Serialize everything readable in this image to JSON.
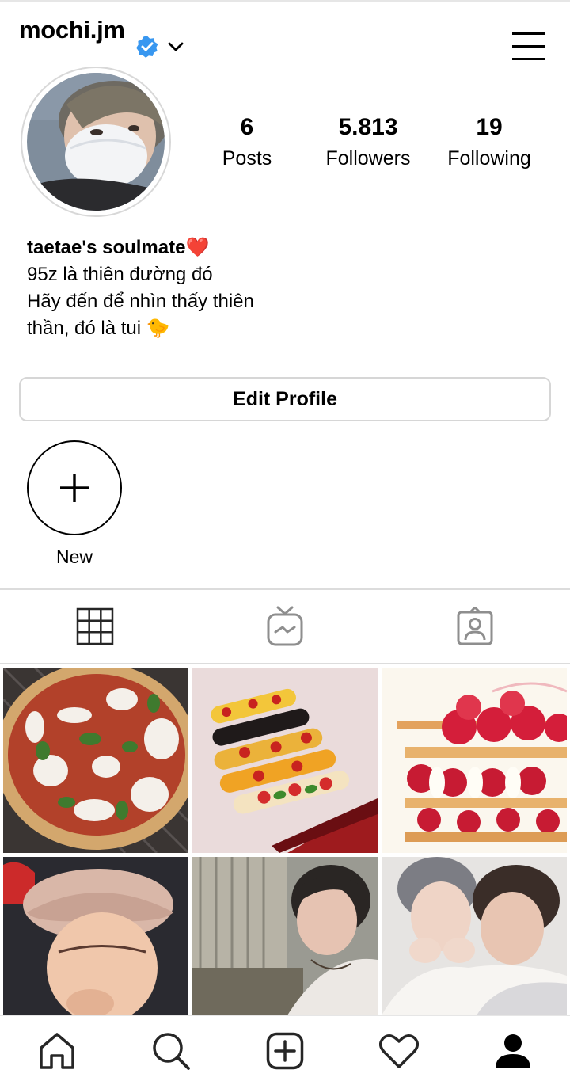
{
  "header": {
    "username": "mochi.jm",
    "verified_icon": "verified-badge-icon",
    "dropdown_icon": "chevron-down-icon",
    "menu_icon": "hamburger-menu-icon"
  },
  "stats": {
    "posts": {
      "value": "6",
      "label": "Posts"
    },
    "followers": {
      "value": "5.813",
      "label": "Followers"
    },
    "following": {
      "value": "19",
      "label": "Following"
    }
  },
  "bio": {
    "name": "taetae's soulmate",
    "name_emoji": "❤️",
    "line1": "95z là thiên đường đó",
    "line2": "Hãy đến để nhìn thấy thiên",
    "line3": "thần, đó là tui",
    "line3_emoji": "🐤"
  },
  "edit_profile_label": "Edit Profile",
  "highlights": {
    "new_label": "New"
  },
  "tabs": [
    {
      "name": "grid-icon"
    },
    {
      "name": "igtv-icon"
    },
    {
      "name": "tagged-icon"
    }
  ],
  "posts": [
    {
      "subject": "pizza"
    },
    {
      "subject": "eclairs"
    },
    {
      "subject": "raspberry mille-feuille"
    },
    {
      "subject": "person in beret"
    },
    {
      "subject": "person outdoors"
    },
    {
      "subject": "two people"
    }
  ],
  "colors": {
    "verified": "#3897f0",
    "border": "#dbdbdb",
    "text": "#000000"
  },
  "bottom_nav": [
    {
      "name": "home-icon"
    },
    {
      "name": "search-icon"
    },
    {
      "name": "new-post-icon"
    },
    {
      "name": "activity-heart-icon"
    },
    {
      "name": "profile-icon"
    }
  ]
}
